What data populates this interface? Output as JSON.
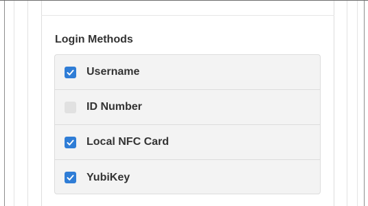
{
  "section": {
    "title": "Login Methods"
  },
  "login_methods": [
    {
      "label": "Username",
      "checked": true
    },
    {
      "label": "ID Number",
      "checked": false
    },
    {
      "label": "Local NFC Card",
      "checked": true
    },
    {
      "label": "YubiKey",
      "checked": true
    }
  ],
  "colors": {
    "checkbox_checked": "#2f7dd6",
    "checkbox_unchecked": "#e1e1e1",
    "list_background": "#f3f3f3",
    "text": "#333333"
  },
  "icons": {
    "checked": "check-icon"
  }
}
